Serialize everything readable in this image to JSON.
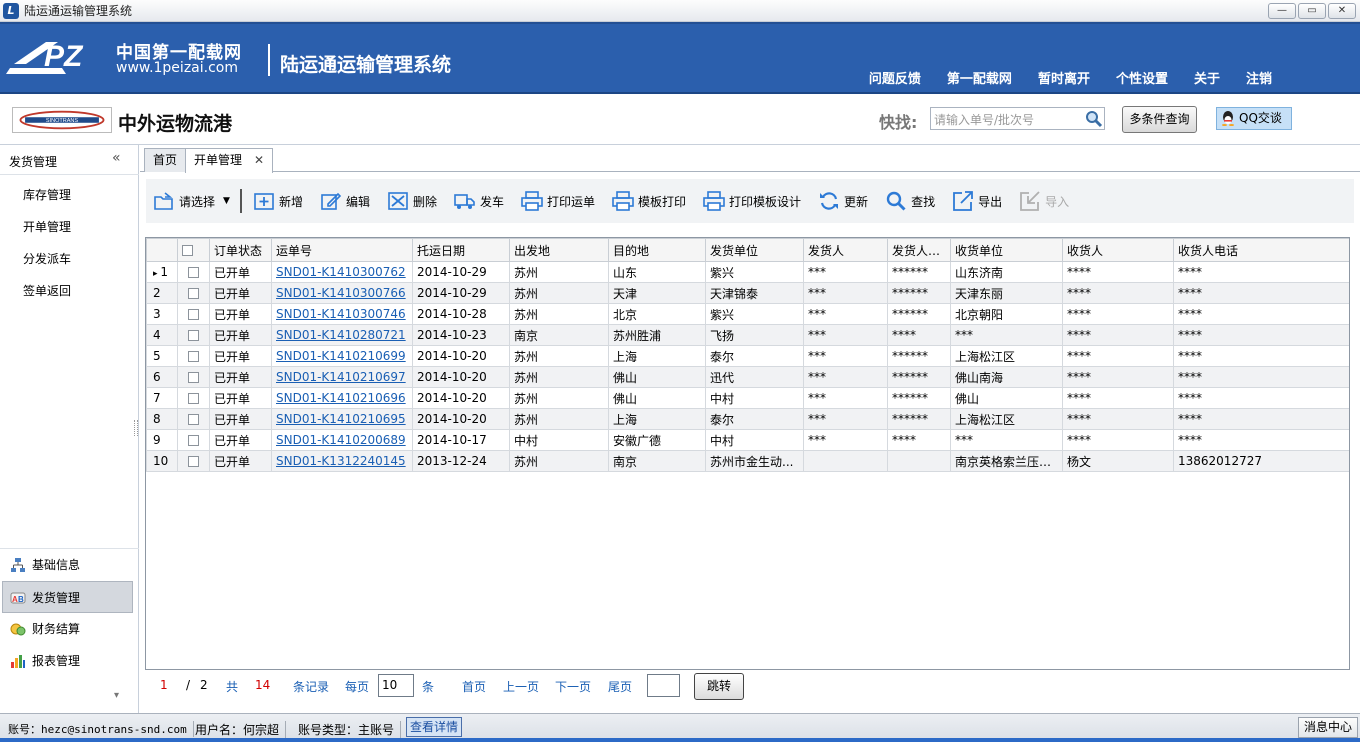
{
  "window": {
    "title": "陆运通运输管理系统",
    "buttons": [
      "—",
      "▭",
      "✕"
    ]
  },
  "header": {
    "logo_text": "PZ",
    "logo_cn": "中国第一配载网",
    "logo_url": "www.1peizai.com",
    "system_title": "陆运通运输管理系统",
    "nav": [
      "问题反馈",
      "第一配载网",
      "暂时离开",
      "个性设置",
      "关于",
      "注销"
    ]
  },
  "company": {
    "name": "中外运物流港",
    "logo_text": "SINOTRANS",
    "quick_search_label": "快找:",
    "quick_search_placeholder": "请输入单号/批次号",
    "multi_search_label": "多条件查询",
    "qq_label": "QQ交谈"
  },
  "sidebar": {
    "title": "发货管理",
    "collapse": "«",
    "items": [
      "库存管理",
      "开单管理",
      "分发派车",
      "签单返回"
    ],
    "modules": [
      {
        "label": "基础信息",
        "icon": "structure-icon"
      },
      {
        "label": "发货管理",
        "icon": "delivery-icon",
        "active": true
      },
      {
        "label": "财务结算",
        "icon": "coins-icon"
      },
      {
        "label": "报表管理",
        "icon": "bar-chart-icon"
      }
    ],
    "more": "▾"
  },
  "tabs": [
    {
      "label": "首页"
    },
    {
      "label": "开单管理",
      "active": true,
      "close": "✕"
    }
  ],
  "toolbar": {
    "select_label": "请选择",
    "buttons": [
      "新增",
      "编辑",
      "删除",
      "发车",
      "打印运单",
      "模板打印",
      "打印模板设计",
      "更新",
      "查找",
      "导出",
      "导入"
    ]
  },
  "grid": {
    "columns": [
      "订单状态",
      "运单号",
      "托运日期",
      "出发地",
      "目的地",
      "发货单位",
      "发货人",
      "发货人电...",
      "收货单位",
      "收货人",
      "收货人电话"
    ],
    "rows": [
      {
        "num": "1",
        "current": true,
        "status": "已开单",
        "waybill": "SND01-K1410300762",
        "date": "2014-10-29",
        "from": "苏州",
        "to": "山东",
        "shipper": "紫兴",
        "sender": "***",
        "sender_tel": "******",
        "consignee_unit": "山东济南",
        "consignee": "****",
        "consignee_tel": "****"
      },
      {
        "num": "2",
        "status": "已开单",
        "waybill": "SND01-K1410300766",
        "date": "2014-10-29",
        "from": "苏州",
        "to": "天津",
        "shipper": "天津锦泰",
        "sender": "***",
        "sender_tel": "******",
        "consignee_unit": "天津东丽",
        "consignee": "****",
        "consignee_tel": "****"
      },
      {
        "num": "3",
        "status": "已开单",
        "waybill": "SND01-K1410300746",
        "date": "2014-10-28",
        "from": "苏州",
        "to": "北京",
        "shipper": "紫兴",
        "sender": "***",
        "sender_tel": "******",
        "consignee_unit": "北京朝阳",
        "consignee": "****",
        "consignee_tel": "****"
      },
      {
        "num": "4",
        "status": "已开单",
        "waybill": "SND01-K1410280721",
        "date": "2014-10-23",
        "from": "南京",
        "to": "苏州胜浦",
        "shipper": "飞扬",
        "sender": "***",
        "sender_tel": "****",
        "consignee_unit": "***",
        "consignee": "****",
        "consignee_tel": "****"
      },
      {
        "num": "5",
        "status": "已开单",
        "waybill": "SND01-K1410210699",
        "date": "2014-10-20",
        "from": "苏州",
        "to": "上海",
        "shipper": "泰尔",
        "sender": "***",
        "sender_tel": "******",
        "consignee_unit": "上海松江区",
        "consignee": "****",
        "consignee_tel": "****"
      },
      {
        "num": "6",
        "status": "已开单",
        "waybill": "SND01-K1410210697",
        "date": "2014-10-20",
        "from": "苏州",
        "to": "佛山",
        "shipper": "迅代",
        "sender": "***",
        "sender_tel": "******",
        "consignee_unit": "佛山南海",
        "consignee": "****",
        "consignee_tel": "****"
      },
      {
        "num": "7",
        "status": "已开单",
        "waybill": "SND01-K1410210696",
        "date": "2014-10-20",
        "from": "苏州",
        "to": "佛山",
        "shipper": "中村",
        "sender": "***",
        "sender_tel": "******",
        "consignee_unit": "佛山",
        "consignee": "****",
        "consignee_tel": "****"
      },
      {
        "num": "8",
        "status": "已开单",
        "waybill": "SND01-K1410210695",
        "date": "2014-10-20",
        "from": "苏州",
        "to": "上海",
        "shipper": "泰尔",
        "sender": "***",
        "sender_tel": "******",
        "consignee_unit": "上海松江区",
        "consignee": "****",
        "consignee_tel": "****"
      },
      {
        "num": "9",
        "status": "已开单",
        "waybill": "SND01-K1410200689",
        "date": "2014-10-17",
        "from": "中村",
        "to": "安徽广德",
        "shipper": "中村",
        "sender": "***",
        "sender_tel": "****",
        "consignee_unit": "***",
        "consignee": "****",
        "consignee_tel": "****"
      },
      {
        "num": "10",
        "status": "已开单",
        "waybill": "SND01-K1312240145",
        "date": "2013-12-24",
        "from": "苏州",
        "to": "南京",
        "shipper": "苏州市金生动...",
        "sender": "",
        "sender_tel": "",
        "consignee_unit": "南京英格索兰压缩...",
        "consignee": "杨文",
        "consignee_tel": "13862012727"
      }
    ]
  },
  "pager": {
    "current_page": "1",
    "slash": "/",
    "total_pages": "2",
    "total_label": "共",
    "total_records": "14",
    "records_label": "条记录",
    "per_page_label": "每页",
    "per_page": "10",
    "per_unit": "条",
    "first": "首页",
    "prev": "上一页",
    "next": "下一页",
    "last": "尾页",
    "go": "跳转",
    "goto_value": ""
  },
  "status": {
    "account": "账号：hezc@sinotrans-snd.com",
    "username": "用户名：何宗超",
    "account_type": "账号类型：主账号",
    "detail_link": "查看详情",
    "message_center": "消息中心"
  }
}
